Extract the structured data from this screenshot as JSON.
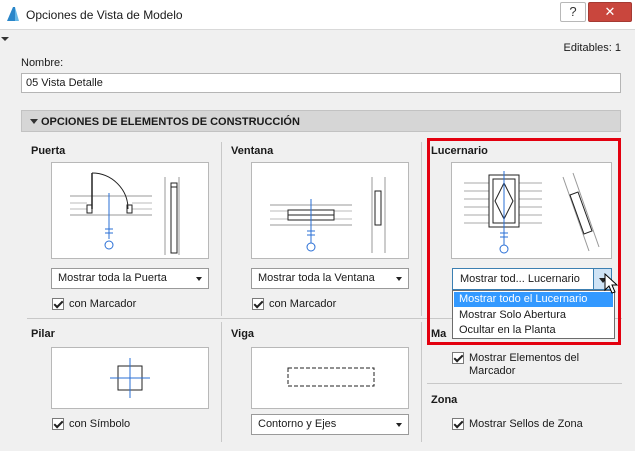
{
  "window": {
    "title": "Opciones de Vista de Modelo",
    "help_label": "?",
    "close_label": "✕"
  },
  "header": {
    "editables": "Editables: 1",
    "name_label": "Nombre:",
    "name_value": "05 Vista Detalle"
  },
  "section": {
    "title": "OPCIONES DE ELEMENTOS DE CONSTRUCCIÓN"
  },
  "puerta": {
    "title": "Puerta",
    "dropdown": "Mostrar toda la Puerta",
    "checkbox": "con Marcador"
  },
  "ventana": {
    "title": "Ventana",
    "dropdown": "Mostrar toda la Ventana",
    "checkbox": "con Marcador"
  },
  "lucernario": {
    "title": "Lucernario",
    "dropdown": "Mostrar tod... Lucernario",
    "options": [
      "Mostrar todo el Lucernario",
      "Mostrar Solo Abertura",
      "Ocultar en la Planta"
    ],
    "selected_index": 0
  },
  "pilar": {
    "title": "Pilar",
    "checkbox": "con Símbolo"
  },
  "viga": {
    "title": "Viga",
    "dropdown": "Contorno y Ejes"
  },
  "marcador": {
    "title_partial": "Ma",
    "checkbox_line1": "Mostrar Elementos del",
    "checkbox_line2": "Marcador"
  },
  "zona": {
    "title": "Zona",
    "checkbox": "Mostrar Sellos de Zona"
  },
  "icons": {
    "app": "archicad-logo-icon",
    "cursor": "mouse-pointer-icon"
  },
  "colors": {
    "accent_blue": "#3399ff",
    "highlight_red": "#e3000f",
    "close_red": "#c9463d",
    "plan_blue": "#2a6fd6"
  }
}
